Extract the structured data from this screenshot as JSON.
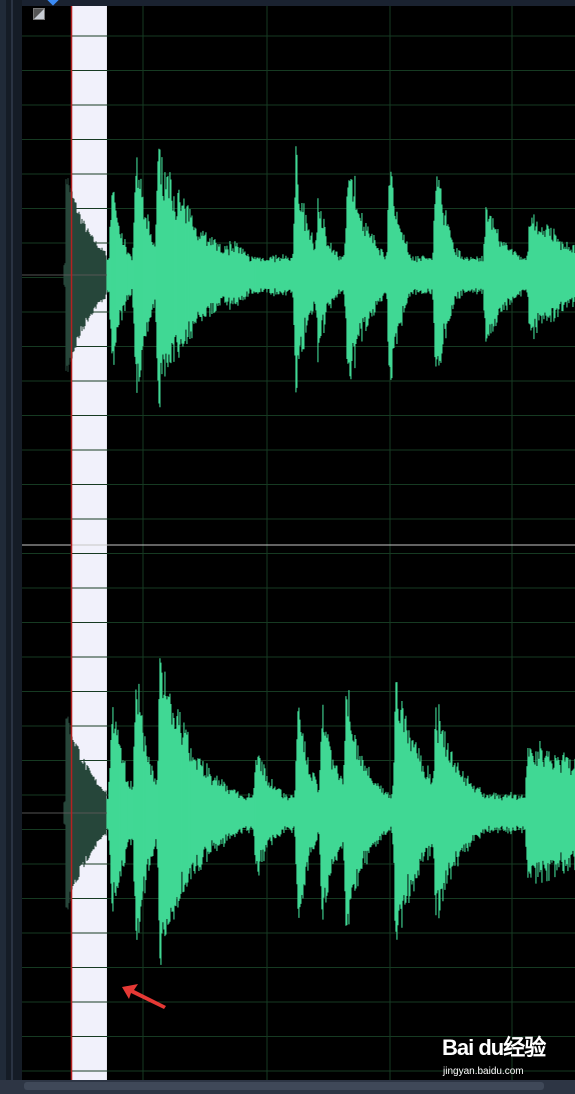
{
  "editor": {
    "selection_start_ratio": 0.057,
    "selection_end_ratio": 0.15,
    "waveform_color": "#41d895",
    "selection_color": "#f1f1fb",
    "selected_waveform_color": "#27463a",
    "grid_color": "#163a22",
    "center_line_color": "#c6c6c6",
    "playhead_color": "#b52121",
    "annotation_arrow_color": "#e53935",
    "channels": [
      "top-channel",
      "bottom-channel"
    ]
  },
  "watermark": {
    "logo": "Bai du经验",
    "url": "jingyan.baidu.com",
    "icon": "paw-icon"
  }
}
